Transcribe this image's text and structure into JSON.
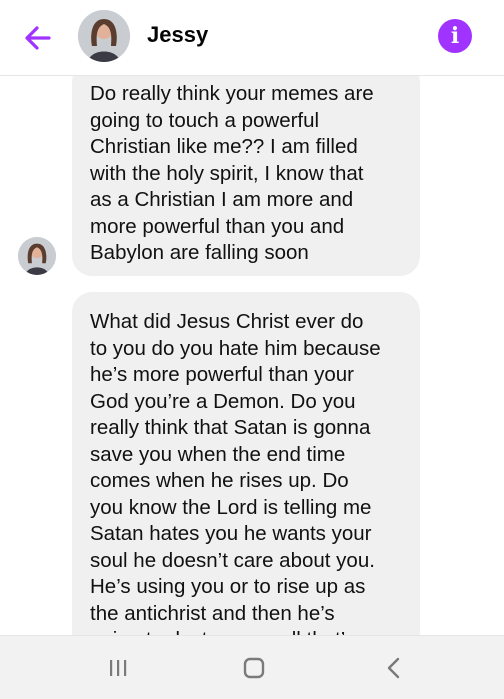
{
  "header": {
    "contact_name": "Jessy",
    "back_icon": "arrow-left-icon",
    "info_icon": "info-icon",
    "info_glyph": "i",
    "accent_color": "#a033ff"
  },
  "messages": [
    {
      "sender": "Jessy",
      "lines": [
        "Do really think your memes are",
        "going to touch a powerful",
        "Christian like me?? I am filled",
        "with the holy spirit, I know that",
        "as a Christian I am more and",
        "more powerful than you and",
        "Babylon are falling soon"
      ]
    },
    {
      "sender": "Jessy",
      "lines": [
        "What did Jesus Christ ever do",
        "to you do you hate him because",
        "he’s more powerful than your",
        "God you’re a Demon. Do you",
        "really think that Satan is gonna",
        "save you when the end time",
        "comes when he rises up. Do",
        "you know the Lord is telling me",
        "Satan hates you he wants your",
        "soul he doesn’t care about you.",
        "He’s using you or to rise up as",
        "the antichrist and then he’s",
        "going to destroy you all that’s"
      ]
    }
  ],
  "navbar": {
    "items": [
      "recent-apps-icon",
      "home-icon",
      "back-icon"
    ]
  }
}
